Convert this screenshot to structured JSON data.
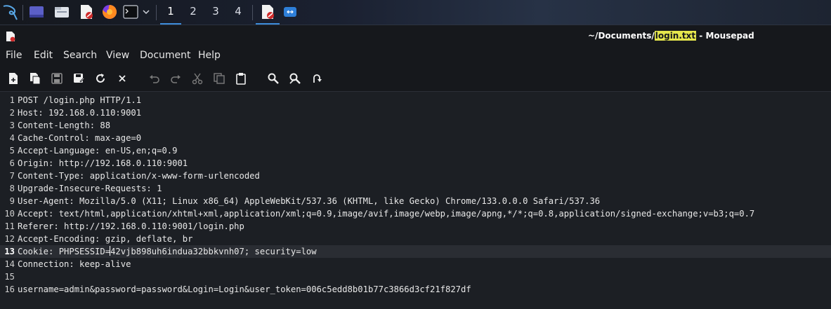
{
  "taskbar": {
    "workspaces": [
      "1",
      "2",
      "3",
      "4"
    ],
    "active_workspace": "1"
  },
  "window": {
    "title_prefix": "~/Documents/",
    "title_file": "login.txt",
    "title_suffix": " - Mousepad"
  },
  "menu": {
    "file": "File",
    "edit": "Edit",
    "search": "Search",
    "view": "View",
    "document": "Document",
    "help": "Help"
  },
  "toolbar": {
    "icons": [
      "new-document-icon",
      "new-window-icon",
      "save-icon",
      "save-as-icon",
      "reload-icon",
      "close-icon",
      "undo-icon",
      "redo-icon",
      "cut-icon",
      "copy-icon",
      "paste-icon",
      "find-icon",
      "find-replace-icon",
      "goto-line-icon"
    ]
  },
  "editor": {
    "current_line": 13,
    "lines": [
      {
        "n": "1",
        "text": "POST /login.php HTTP/1.1"
      },
      {
        "n": "2",
        "text": "Host: 192.168.0.110:9001"
      },
      {
        "n": "3",
        "text": "Content-Length: 88"
      },
      {
        "n": "4",
        "text": "Cache-Control: max-age=0"
      },
      {
        "n": "5",
        "text": "Accept-Language: en-US,en;q=0.9"
      },
      {
        "n": "6",
        "text": "Origin: http://192.168.0.110:9001"
      },
      {
        "n": "7",
        "text": "Content-Type: application/x-www-form-urlencoded"
      },
      {
        "n": "8",
        "text": "Upgrade-Insecure-Requests: 1"
      },
      {
        "n": "9",
        "text": "User-Agent: Mozilla/5.0 (X11; Linux x86_64) AppleWebKit/537.36 (KHTML, like Gecko) Chrome/133.0.0.0 Safari/537.36"
      },
      {
        "n": "10",
        "text": "Accept: text/html,application/xhtml+xml,application/xml;q=0.9,image/avif,image/webp,image/apng,*/*;q=0.8,application/signed-exchange;v=b3;q=0.7"
      },
      {
        "n": "11",
        "text": "Referer: http://192.168.0.110:9001/login.php"
      },
      {
        "n": "12",
        "text": "Accept-Encoding: gzip, deflate, br"
      },
      {
        "n": "13",
        "text_before_cursor": "Cookie: PHPSESSID=",
        "text_after_cursor": "42vjb898uh6indua32bbkvnh07; security=low"
      },
      {
        "n": "14",
        "text": "Connection: keep-alive"
      },
      {
        "n": "15",
        "text": ""
      },
      {
        "n": "16",
        "text": "username=admin&password=password&Login=Login&user_token=006c5edd8b01b77c3866d3cf21f827df"
      }
    ]
  }
}
